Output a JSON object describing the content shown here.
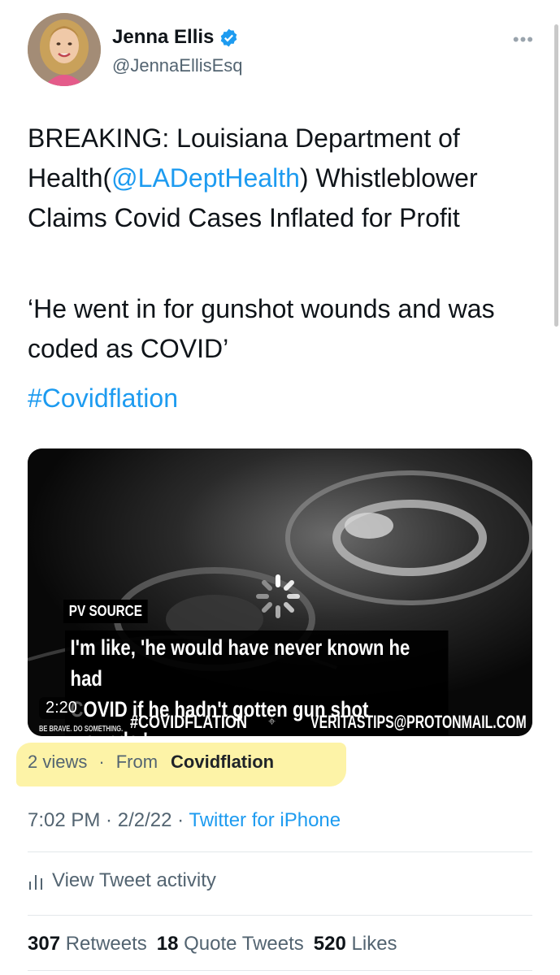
{
  "tweet": {
    "author": {
      "display_name": "Jenna Ellis",
      "handle": "@JennaEllisEsq",
      "verified": true,
      "icons": {
        "verified": "verified-badge-icon",
        "more": "more-options-icon"
      }
    },
    "text": {
      "line1_before": "BREAKING: Louisiana Department of Health(",
      "mention": "@LADeptHealth",
      "line1_after": ") Whistleblower Claims Covid Cases Inflated for Profit",
      "quote": "‘He went in for gunshot wounds and was coded as COVID’",
      "hashtag": "#Covidflation"
    },
    "media": {
      "pv_source": "PV SOURCE",
      "caption_line1": "I'm like, 'he would have never known he had",
      "caption_line2": "COVID if he hadn't gotten gun shot wounds.'",
      "duration": "2:20",
      "brand_tag": "BE BRAVE. DO SOMETHING.",
      "hashtag_overlay": "#COVIDFLATION",
      "email_overlay": "VERITASTIPS@PROTONMAIL.COM",
      "spinner_icon": "loading-spinner-icon"
    },
    "views": {
      "count_label": "2 views",
      "separator": "·",
      "from_label": "From",
      "from_name": "Covidflation",
      "highlight_color": "#fdf3a7"
    },
    "meta": {
      "time": "7:02 PM",
      "sep1": " · ",
      "date": "2/2/22",
      "sep2": " · ",
      "source": "Twitter for iPhone"
    },
    "activity_label": "View Tweet activity",
    "stats": {
      "retweets_count": "307",
      "retweets_label": "Retweets",
      "quotes_count": "18",
      "quotes_label": "Quote Tweets",
      "likes_count": "520",
      "likes_label": "Likes"
    }
  },
  "colors": {
    "link_blue": "#1d9bf0",
    "secondary_text": "#536471",
    "primary_text": "#0f1419"
  }
}
